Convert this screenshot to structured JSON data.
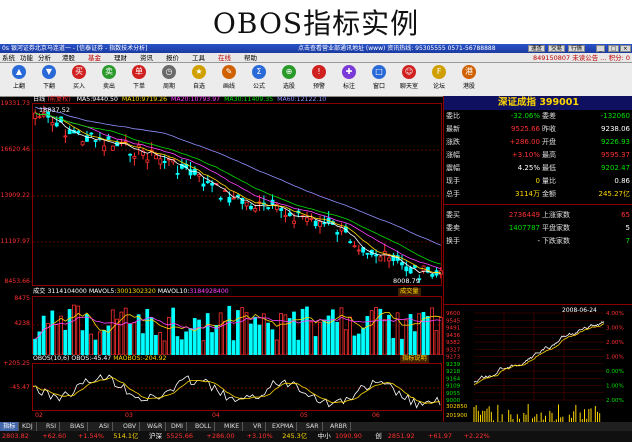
{
  "page_title": "OBOS指标实例",
  "titlebar": {
    "left": "0s 银河证券北京马连道一 - [信泰证券 - 指数技术分析]",
    "right": "点击查看营业部通讯地址 (www) 资讯热线: 95305555 0571-56788888",
    "buttons": [
      "速查",
      "交易",
      "行情"
    ]
  },
  "menubar": {
    "items": [
      "系统",
      "功能",
      "分析",
      "港股",
      "基金",
      "理财",
      "资讯",
      "报价",
      "工具",
      "在线",
      "帮助"
    ],
    "account": "849150807 未读公告 ...",
    "flag": "积分: 0"
  },
  "toolbar": {
    "buttons": [
      {
        "label": "上翻",
        "icon": "arrow-up-icon",
        "color": "#2a6ad8",
        "glyph": "▲"
      },
      {
        "label": "下翻",
        "icon": "arrow-down-icon",
        "color": "#2a6ad8",
        "glyph": "▼"
      },
      {
        "label": "买入",
        "icon": "buy-icon",
        "color": "#d02020",
        "glyph": "买"
      },
      {
        "label": "卖出",
        "icon": "sell-icon",
        "color": "#2a9a2a",
        "glyph": "卖"
      },
      {
        "label": "下单",
        "icon": "order-icon",
        "color": "#d02020",
        "glyph": "单"
      },
      {
        "label": "周期",
        "icon": "period-icon",
        "color": "#6a6a6a",
        "glyph": "◷"
      },
      {
        "label": "自选",
        "icon": "star-icon",
        "color": "#d0a000",
        "glyph": "★"
      },
      {
        "label": "画线",
        "icon": "pen-icon",
        "color": "#d06000",
        "glyph": "✎"
      },
      {
        "label": "公式",
        "icon": "formula-icon",
        "color": "#2a6ad8",
        "glyph": "Σ"
      },
      {
        "label": "选股",
        "icon": "filter-icon",
        "color": "#2a9a2a",
        "glyph": "⊕"
      },
      {
        "label": "预警",
        "icon": "bell-icon",
        "color": "#d02020",
        "glyph": "!"
      },
      {
        "label": "标注",
        "icon": "tag-icon",
        "color": "#7a3ad8",
        "glyph": "✚"
      },
      {
        "label": "窗口",
        "icon": "window-icon",
        "color": "#2a6ad8",
        "glyph": "□"
      },
      {
        "label": "聊天室",
        "icon": "chat-icon",
        "color": "#d02020",
        "glyph": "☺"
      },
      {
        "label": "论坛",
        "icon": "forum-icon",
        "color": "#d0a000",
        "glyph": "F"
      },
      {
        "label": "港股",
        "icon": "hk-icon",
        "color": "#d06000",
        "glyph": "港"
      }
    ]
  },
  "chart_header": {
    "period": "日线",
    "type": "(前复权)",
    "ma": [
      {
        "label": "MA5:",
        "value": "9440.50",
        "color": "#ffffff"
      },
      {
        "label": "MA10:",
        "value": "9719.26",
        "color": "#ffd700"
      },
      {
        "label": "MA20:",
        "value": "10793.97",
        "color": "#ff40ff"
      },
      {
        "label": "MA30:",
        "value": "11409.35",
        "color": "#00e000"
      },
      {
        "label": "MA60:",
        "value": "12122.10",
        "color": "#9090ff"
      }
    ]
  },
  "price_axis": [
    "19331.73",
    "16620.46",
    "13909.22",
    "11197.97",
    "8453.66"
  ],
  "price_annotations": {
    "high": "18837.52",
    "low": "8008.79"
  },
  "volume_header": {
    "label": "成交",
    "value": "3114104000",
    "mavol5_label": "MAVOL5:",
    "mavol5": "3001302320",
    "mavol10_label": "MAVOL10:",
    "mavol10": "3184928400",
    "button": "成交量"
  },
  "volume_axis": [
    "8475",
    "4238"
  ],
  "osc_header": {
    "label": "OBOS(10,6)",
    "obos_label": "OBOS:",
    "obos": "-45.47",
    "maobos_label": "MAOBOS:",
    "maobos": "-204.92",
    "button": "指标说明"
  },
  "osc_axis": [
    "+205.25",
    "-45.47"
  ],
  "time_axis": [
    "02",
    "03",
    "04",
    "05",
    "06"
  ],
  "right_panel": {
    "name": "深证成指 399001",
    "rows": [
      {
        "k1": "委比",
        "v1": "-32.06%",
        "k2": "委差",
        "v2": "-132060",
        "c1": "#00e000",
        "c2": "#00e000"
      },
      {
        "k1": "最新",
        "v1": "9525.66",
        "k2": "昨收",
        "v2": "9238.06",
        "c1": "#ff3030",
        "c2": "#ffffff"
      },
      {
        "k1": "涨跌",
        "v1": "+286.00",
        "k2": "开盘",
        "v2": "9226.93",
        "c1": "#ff3030",
        "c2": "#00e000"
      },
      {
        "k1": "涨幅",
        "v1": "+3.10%",
        "k2": "最高",
        "v2": "9595.37",
        "c1": "#ff3030",
        "c2": "#ff3030"
      },
      {
        "k1": "震幅",
        "v1": "4.25%",
        "k2": "最低",
        "v2": "9202.47",
        "c1": "#ffffff",
        "c2": "#00e000"
      },
      {
        "k1": "现手",
        "v1": "0",
        "k2": "量比",
        "v2": "0.86",
        "c1": "#ffd700",
        "c2": "#ffffff"
      },
      {
        "k1": "总手",
        "v1": "3114万",
        "k2": "金额",
        "v2": "245.27亿",
        "c1": "#ffd700",
        "c2": "#ffd700"
      },
      {
        "k1": "委买",
        "v1": "2736449",
        "k2": "上涨家数",
        "v2": "65",
        "c1": "#ff3030",
        "c2": "#ff3030"
      },
      {
        "k1": "委卖",
        "v1": "1407787",
        "k2": "平盘家数",
        "v2": "5",
        "c1": "#00e000",
        "c2": "#ffffff"
      },
      {
        "k1": "换手",
        "v1": "-",
        "k2": "下跌家数",
        "v2": "7",
        "c1": "#ffffff",
        "c2": "#00e000"
      }
    ],
    "mini": {
      "date": "2008-06-24",
      "y_left": [
        "9600",
        "9545",
        "9491",
        "9436",
        "9382",
        "9327",
        "9273",
        "9239",
        "9218",
        "9164",
        "9109",
        "9055",
        "9000"
      ],
      "y_right": [
        "4.00%",
        "3.00%",
        "2.00%",
        "1.00%",
        "0.00%",
        "1.00%",
        "2.00%"
      ],
      "vol_labels": [
        "302850",
        "201900",
        "164360"
      ]
    }
  },
  "tabs": [
    "指标",
    "KDJ",
    "RSI",
    "BIAS",
    "ASI",
    "OBV",
    "W&R",
    "DMI",
    "BOLL",
    "MIKE",
    "VR",
    "EXPMA",
    "SAR",
    "ARBR"
  ],
  "status": [
    {
      "text": "2803.82",
      "color": "#ff3030"
    },
    {
      "text": "+62.60",
      "color": "#ff3030"
    },
    {
      "text": "+1.54%",
      "color": "#ff3030"
    },
    {
      "text": "514.1亿",
      "color": "#ffd700"
    },
    {
      "text": "沪深",
      "color": "#ffffff"
    },
    {
      "text": "5525.66",
      "color": "#ff3030"
    },
    {
      "text": "+286.00",
      "color": "#ff3030"
    },
    {
      "text": "+3.10%",
      "color": "#ff3030"
    },
    {
      "text": "245.3亿",
      "color": "#ffd700"
    },
    {
      "text": "中小",
      "color": "#ffffff"
    },
    {
      "text": "1090.90",
      "color": "#ff3030"
    },
    {
      "text": "创",
      "color": "#ffffff"
    },
    {
      "text": "2851.92",
      "color": "#ff3030"
    },
    {
      "text": "+61.97",
      "color": "#ff3030"
    },
    {
      "text": "+2.22%",
      "color": "#ff3030"
    }
  ]
}
